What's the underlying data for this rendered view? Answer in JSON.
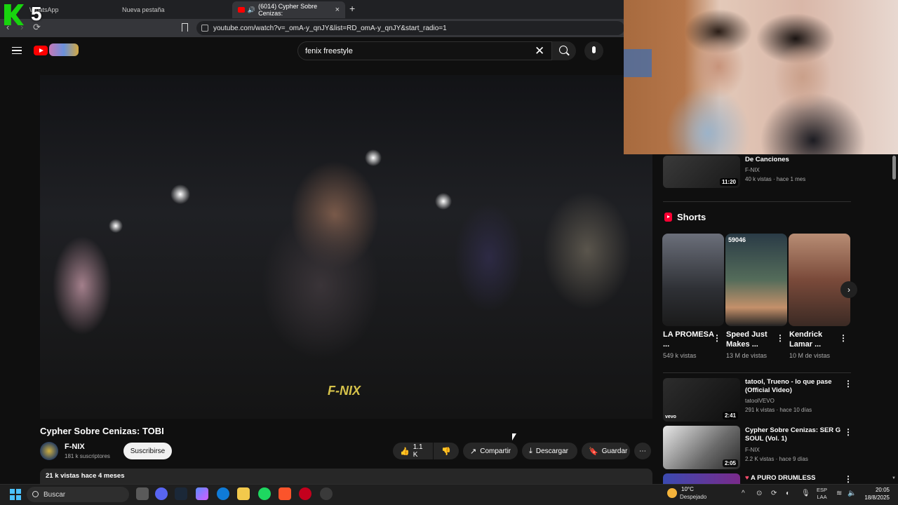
{
  "browser": {
    "tabs": [
      {
        "label": "WhatsApp"
      },
      {
        "label": "Nueva pestaña"
      },
      {
        "label": "(6014) Cypher Sobre Cenizas:"
      }
    ],
    "new_tab": "+",
    "close": "×",
    "url": "youtube.com/watch?v=_omA-y_qnJY&list=RD_omA-y_qnJY&start_radio=1",
    "back": "‹",
    "forward": "›",
    "reload": "⟳"
  },
  "overlay": {
    "counter": "5"
  },
  "youtube": {
    "search_query": "fenix freestyle",
    "clear": "✕"
  },
  "video": {
    "watermark": "F-NIX",
    "title": "Cypher Sobre Cenizas: TOBI",
    "channel": "F-NIX",
    "subscribers": "181 k suscriptores",
    "subscribe_label": "Suscribirse",
    "likes": "1.1 K",
    "share_label": "Compartir",
    "download_label": "Descargar",
    "save_label": "Guardar",
    "more": "⋯",
    "views_date": "21 k vistas  hace 4 meses"
  },
  "sidebar": {
    "top_item": {
      "title": "De Canciones",
      "channel": "F-NIX",
      "meta": "40 k vistas · hace 1 mes",
      "duration": "11:20"
    },
    "shorts_heading": "Shorts",
    "shorts": [
      {
        "title": "LA PROMESA ...",
        "views": "549 k vistas",
        "badge": ""
      },
      {
        "title": "Speed Just Makes ...",
        "views": "13 M de vistas",
        "badge": "59046"
      },
      {
        "title": "Kendrick Lamar ...",
        "views": "10 M de vistas",
        "badge": ""
      }
    ],
    "next": "›",
    "videos": [
      {
        "title": "tatool, Trueno - lo que pase (Official Video)",
        "channel": "tatoolVEVO",
        "meta": "291 k vistas · hace 10 días",
        "duration": "2:41",
        "badge": "vevo"
      },
      {
        "title": "Cypher Sobre Cenizas: SER G SOUL (Vol. 1)",
        "channel": "F-NIX",
        "meta": "2.2 K vistas · hace 9 días",
        "duration": "2:05"
      },
      {
        "title": "A PURO DRUMLESS",
        "channel": "",
        "meta": "",
        "duration": ""
      }
    ],
    "kebab": "⋮"
  },
  "taskbar": {
    "search_label": "Buscar",
    "weather_temp": "10°C",
    "weather_desc": "Despejado",
    "lang_line1": "ESP",
    "lang_line2": "LAA",
    "time": "20:05",
    "date": "18/8/2025",
    "tray_chevron": "^"
  },
  "colors": {
    "youtube_red": "#ff0000",
    "background": "#0f0f0f",
    "pill": "#272727",
    "windows_accent": "#4cc2ff"
  }
}
